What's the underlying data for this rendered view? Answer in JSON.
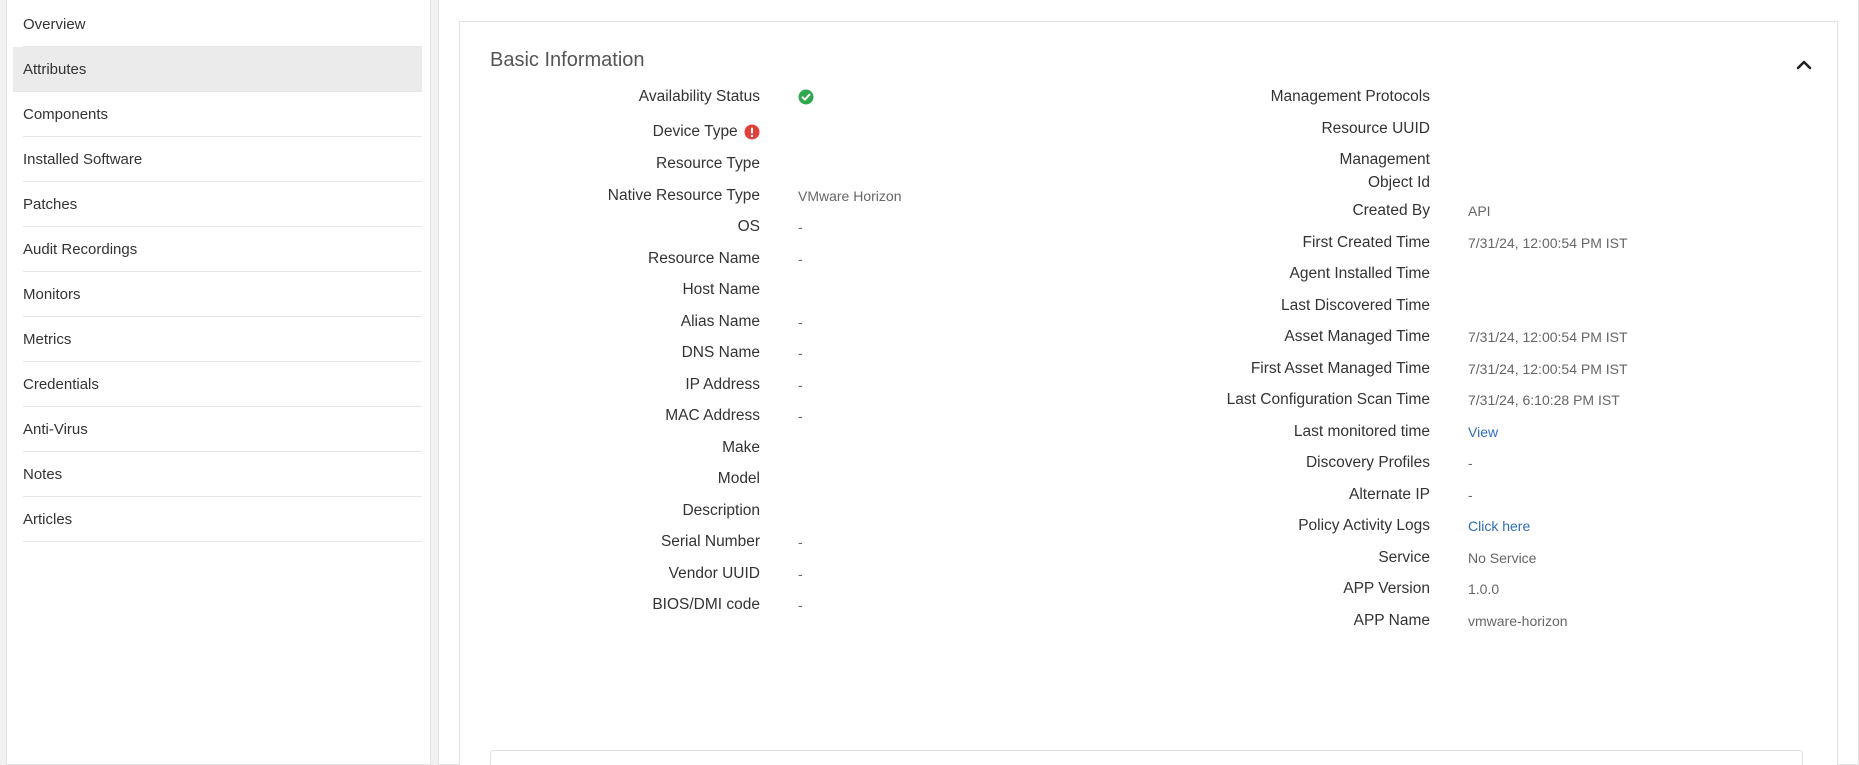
{
  "sidebar": {
    "items": [
      {
        "label": "Overview"
      },
      {
        "label": "Attributes"
      },
      {
        "label": "Components"
      },
      {
        "label": "Installed Software"
      },
      {
        "label": "Patches"
      },
      {
        "label": "Audit Recordings"
      },
      {
        "label": "Monitors"
      },
      {
        "label": "Metrics"
      },
      {
        "label": "Credentials"
      },
      {
        "label": "Anti-Virus"
      },
      {
        "label": "Notes"
      },
      {
        "label": "Articles"
      }
    ],
    "active_index": 1
  },
  "panel": {
    "title": "Basic Information"
  },
  "left_fields": [
    {
      "label": "Availability Status",
      "value": "",
      "icon": "check-circle-icon"
    },
    {
      "label": "Device Type",
      "value": "",
      "label_icon": "error-icon"
    },
    {
      "label": "Resource Type",
      "value": ""
    },
    {
      "label": "Native Resource Type",
      "value": "VMware Horizon"
    },
    {
      "label": "OS",
      "value": "-"
    },
    {
      "label": "Resource Name",
      "value": "-"
    },
    {
      "label": "Host Name",
      "value": ""
    },
    {
      "label": "Alias Name",
      "value": "-"
    },
    {
      "label": "DNS Name",
      "value": "-"
    },
    {
      "label": "IP Address",
      "value": "-"
    },
    {
      "label": "MAC Address",
      "value": "-"
    },
    {
      "label": "Make",
      "value": ""
    },
    {
      "label": "Model",
      "value": ""
    },
    {
      "label": "Description",
      "value": ""
    },
    {
      "label": "Serial Number",
      "value": "-"
    },
    {
      "label": "Vendor UUID",
      "value": "-"
    },
    {
      "label": "BIOS/DMI code",
      "value": "-"
    }
  ],
  "right_fields": [
    {
      "label": "Management Protocols",
      "value": ""
    },
    {
      "label": "Resource UUID",
      "value": ""
    },
    {
      "label": "Management",
      "label2": "Object Id",
      "value": ""
    },
    {
      "label": "Created By",
      "value": "API"
    },
    {
      "label": "First Created Time",
      "value": "7/31/24, 12:00:54 PM IST"
    },
    {
      "label": "Agent Installed Time",
      "value": ""
    },
    {
      "label": "Last Discovered Time",
      "value": ""
    },
    {
      "label": "Asset Managed Time",
      "value": "7/31/24, 12:00:54 PM IST"
    },
    {
      "label": "First Asset Managed Time",
      "value": "7/31/24, 12:00:54 PM IST"
    },
    {
      "label": "Last Configuration Scan Time",
      "value": "7/31/24, 6:10:28 PM IST"
    },
    {
      "label": "Last monitored time",
      "value": "View",
      "link": true
    },
    {
      "label": "Discovery Profiles",
      "value": "-"
    },
    {
      "label": "Alternate IP",
      "value": "-"
    },
    {
      "label": "Policy Activity Logs",
      "value": "Click here",
      "link": true
    },
    {
      "label": "Service",
      "value": "No Service"
    },
    {
      "label": "APP Version",
      "value": "1.0.0"
    },
    {
      "label": "APP Name",
      "value": "vmware-horizon"
    }
  ],
  "colors": {
    "accent_link": "#2f6db5",
    "status_ok": "#2fa84f",
    "status_error": "#e0403a"
  }
}
